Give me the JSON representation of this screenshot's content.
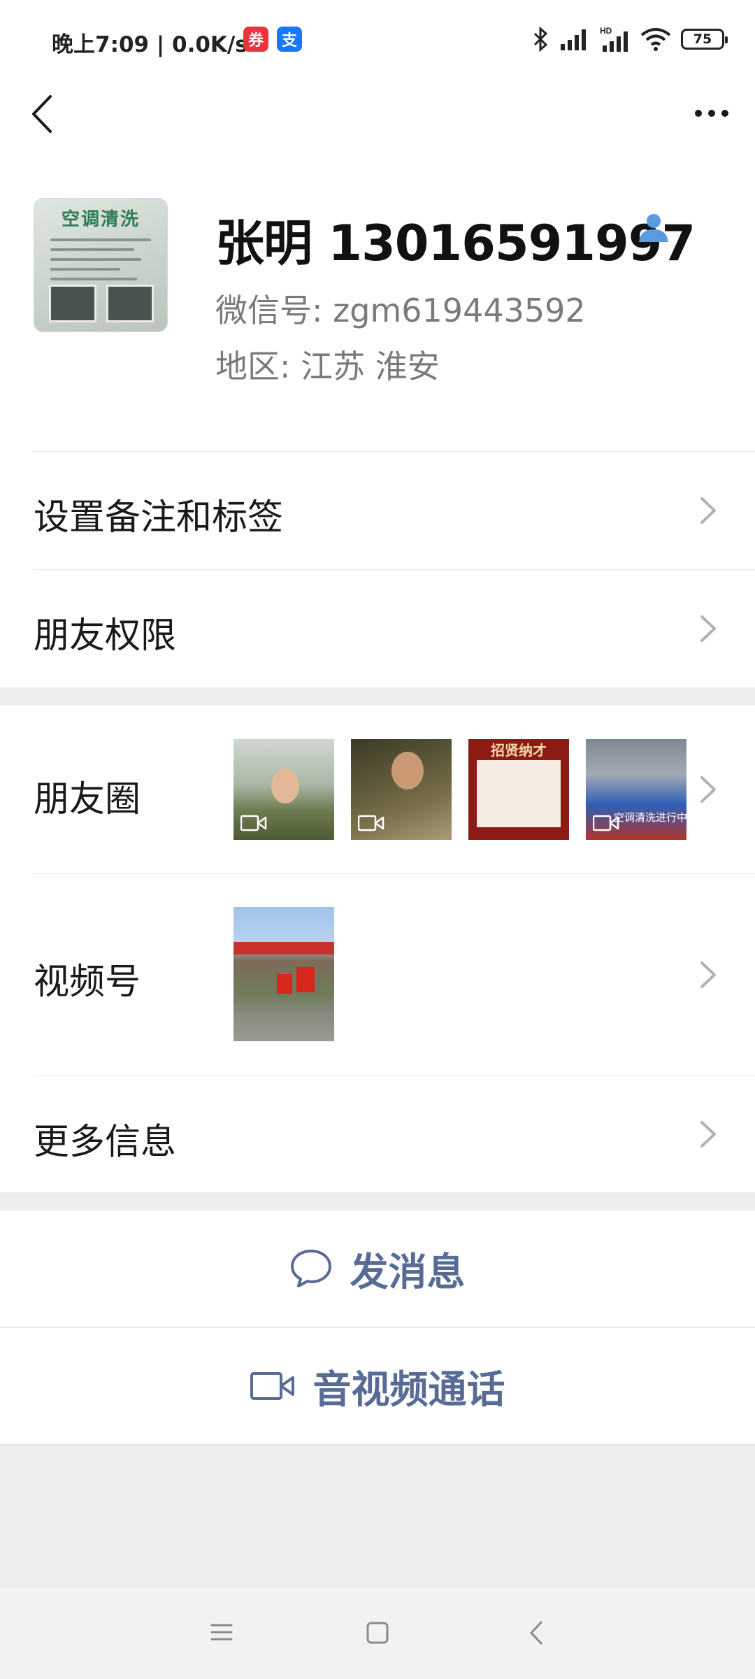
{
  "status_bar": {
    "time_text": "晚上7:09 | 0.0K/s",
    "app_icon_1": "券",
    "app_icon_2": "支",
    "battery_level": "75",
    "icons": [
      "bluetooth-icon",
      "signal-icon",
      "hd-signal-icon",
      "wifi-icon",
      "battery-icon"
    ]
  },
  "header": {
    "back_icon": "chevron-left-icon",
    "more_icon": "more-dots-icon"
  },
  "profile": {
    "avatar_text": "空调清洗",
    "name": "张明 13016591997",
    "wechat_id": "微信号:  zgm619443592",
    "region": "地区:  江苏  淮安"
  },
  "menu": {
    "remark_tags": "设置备注和标签",
    "friend_permissions": "朋友权限",
    "moments": "朋友圈",
    "channels": "视频号",
    "more_info": "更多信息"
  },
  "moments_thumbs": [
    {
      "video": true,
      "caption": ""
    },
    {
      "video": true,
      "caption": ""
    },
    {
      "video": false,
      "caption": "招贤纳才"
    },
    {
      "video": true,
      "caption": "空调清洗进行中"
    }
  ],
  "actions": {
    "send_message": "发消息",
    "av_call": "音视频通话"
  },
  "colors": {
    "link": "#576b95",
    "band": "#ededed",
    "name_icon": "#5a9be0"
  }
}
